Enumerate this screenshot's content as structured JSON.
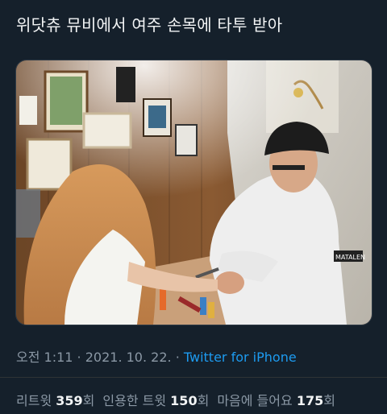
{
  "tweet": {
    "text": "위닷츄 뮤비에서 여주 손목에 타투 받아"
  },
  "photo": {
    "patch_text": "MATALEN"
  },
  "meta": {
    "time": "오전 1:11",
    "sep1": " · ",
    "date": "2021. 10. 22.",
    "sep2": " · ",
    "source": "Twitter for iPhone"
  },
  "stats": {
    "retweets_label": "리트윗 ",
    "retweets_count": "359",
    "retweets_unit": "회",
    "quotes_label": "인용한 트윗 ",
    "quotes_count": "150",
    "quotes_unit": "회",
    "likes_label": "마음에 들어요 ",
    "likes_count": "175",
    "likes_unit": "회"
  }
}
